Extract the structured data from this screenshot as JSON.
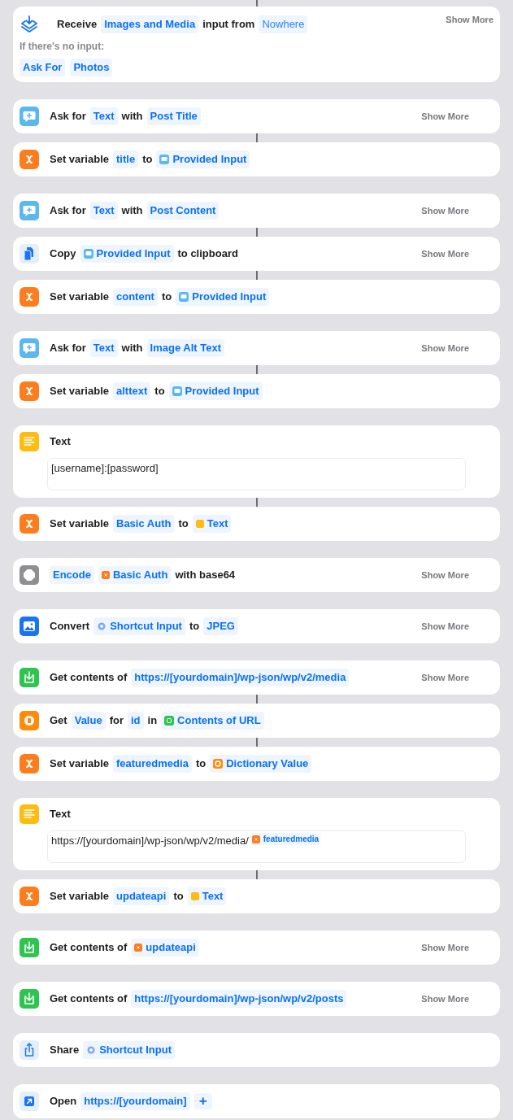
{
  "groups": [
    {
      "actions": [
        {
          "kind": "receive",
          "parts": [
            {
              "kind": "label",
              "text": "Receive"
            },
            {
              "kind": "token",
              "text": "Images and Media"
            },
            {
              "kind": "label",
              "text": "input from"
            },
            {
              "kind": "plain-token",
              "text": "Nowhere"
            }
          ],
          "show_more": "Show More",
          "subtitle": "If there's no input:",
          "chips": [
            "Ask For",
            "Photos"
          ]
        }
      ]
    },
    {
      "actions": [
        {
          "kind": "ask",
          "parts": [
            {
              "kind": "label",
              "text": "Ask for"
            },
            {
              "kind": "token",
              "text": "Text"
            },
            {
              "kind": "label",
              "text": "with"
            },
            {
              "kind": "token",
              "text": "Post Title"
            }
          ],
          "show_more": "Show More"
        },
        {
          "kind": "set-variable",
          "parts": [
            {
              "kind": "label",
              "text": "Set variable"
            },
            {
              "kind": "token",
              "text": "title"
            },
            {
              "kind": "label",
              "text": "to"
            },
            {
              "kind": "input-var",
              "text": "Provided Input"
            }
          ]
        }
      ]
    },
    {
      "actions": [
        {
          "kind": "ask",
          "parts": [
            {
              "kind": "label",
              "text": "Ask for"
            },
            {
              "kind": "token",
              "text": "Text"
            },
            {
              "kind": "label",
              "text": "with"
            },
            {
              "kind": "token",
              "text": "Post Content"
            }
          ],
          "show_more": "Show More"
        },
        {
          "kind": "copy",
          "parts": [
            {
              "kind": "label",
              "text": "Copy"
            },
            {
              "kind": "input-var",
              "text": "Provided Input"
            },
            {
              "kind": "label",
              "text": "to clipboard"
            }
          ],
          "show_more": "Show More"
        },
        {
          "kind": "set-variable",
          "parts": [
            {
              "kind": "label",
              "text": "Set variable"
            },
            {
              "kind": "token",
              "text": "content"
            },
            {
              "kind": "label",
              "text": "to"
            },
            {
              "kind": "input-var",
              "text": "Provided Input"
            }
          ]
        }
      ]
    },
    {
      "actions": [
        {
          "kind": "ask",
          "parts": [
            {
              "kind": "label",
              "text": "Ask for"
            },
            {
              "kind": "token",
              "text": "Text"
            },
            {
              "kind": "label",
              "text": "with"
            },
            {
              "kind": "token",
              "text": "Image Alt Text"
            }
          ],
          "show_more": "Show More"
        },
        {
          "kind": "set-variable",
          "parts": [
            {
              "kind": "label",
              "text": "Set variable"
            },
            {
              "kind": "token",
              "text": "alttext"
            },
            {
              "kind": "label",
              "text": "to"
            },
            {
              "kind": "input-var",
              "text": "Provided Input"
            }
          ]
        }
      ]
    },
    {
      "actions": [
        {
          "kind": "text",
          "title": "Text",
          "content": [
            {
              "kind": "plain",
              "text": "[username]:[password]"
            }
          ]
        },
        {
          "kind": "set-variable",
          "parts": [
            {
              "kind": "label",
              "text": "Set variable"
            },
            {
              "kind": "token",
              "text": "Basic Auth"
            },
            {
              "kind": "label",
              "text": "to"
            },
            {
              "kind": "text-var",
              "text": "Text"
            }
          ]
        }
      ]
    },
    {
      "actions": [
        {
          "kind": "encode",
          "parts": [
            {
              "kind": "token",
              "text": "Encode"
            },
            {
              "kind": "named-var",
              "text": "Basic Auth"
            },
            {
              "kind": "label",
              "text": "with base64"
            }
          ],
          "show_more": "Show More"
        }
      ]
    },
    {
      "actions": [
        {
          "kind": "convert",
          "parts": [
            {
              "kind": "label",
              "text": "Convert"
            },
            {
              "kind": "shortcut-var",
              "text": "Shortcut Input"
            },
            {
              "kind": "label",
              "text": "to"
            },
            {
              "kind": "token",
              "text": "JPEG"
            }
          ],
          "show_more": "Show More"
        }
      ]
    },
    {
      "actions": [
        {
          "kind": "get-contents",
          "parts": [
            {
              "kind": "label",
              "text": "Get contents of"
            },
            {
              "kind": "token",
              "text": "https://[yourdomain]/wp-json/wp/v2/media"
            }
          ],
          "show_more": "Show More"
        },
        {
          "kind": "get-value",
          "parts": [
            {
              "kind": "label",
              "text": "Get"
            },
            {
              "kind": "token",
              "text": "Value"
            },
            {
              "kind": "label",
              "text": "for"
            },
            {
              "kind": "token",
              "text": "id"
            },
            {
              "kind": "label",
              "text": "in"
            },
            {
              "kind": "url-var",
              "text": "Contents of URL"
            }
          ]
        },
        {
          "kind": "set-variable",
          "parts": [
            {
              "kind": "label",
              "text": "Set variable"
            },
            {
              "kind": "token",
              "text": "featuredmedia"
            },
            {
              "kind": "label",
              "text": "to"
            },
            {
              "kind": "dictionary-var",
              "text": "Dictionary Value"
            }
          ]
        }
      ]
    },
    {
      "actions": [
        {
          "kind": "text",
          "title": "Text",
          "content": [
            {
              "kind": "plain",
              "text": "https://[yourdomain]/wp-json/wp/v2/media/"
            },
            {
              "kind": "named-var",
              "text": "featuredmedia"
            }
          ]
        },
        {
          "kind": "set-variable",
          "parts": [
            {
              "kind": "label",
              "text": "Set variable"
            },
            {
              "kind": "token",
              "text": "updateapi"
            },
            {
              "kind": "label",
              "text": "to"
            },
            {
              "kind": "text-var",
              "text": "Text"
            }
          ]
        }
      ]
    },
    {
      "actions": [
        {
          "kind": "get-contents",
          "parts": [
            {
              "kind": "label",
              "text": "Get contents of"
            },
            {
              "kind": "named-var",
              "text": "updateapi"
            }
          ],
          "show_more": "Show More"
        }
      ]
    },
    {
      "actions": [
        {
          "kind": "get-contents",
          "parts": [
            {
              "kind": "label",
              "text": "Get contents of"
            },
            {
              "kind": "token",
              "text": "https://[yourdomain]/wp-json/wp/v2/posts"
            }
          ],
          "show_more": "Show More"
        }
      ]
    },
    {
      "actions": [
        {
          "kind": "share",
          "parts": [
            {
              "kind": "label",
              "text": "Share"
            },
            {
              "kind": "shortcut-var",
              "text": "Shortcut Input"
            }
          ]
        }
      ]
    },
    {
      "actions": [
        {
          "kind": "open",
          "parts": [
            {
              "kind": "label",
              "text": "Open"
            },
            {
              "kind": "token",
              "text": "https://[yourdomain]"
            },
            {
              "kind": "add",
              "text": "+"
            }
          ]
        }
      ]
    }
  ]
}
